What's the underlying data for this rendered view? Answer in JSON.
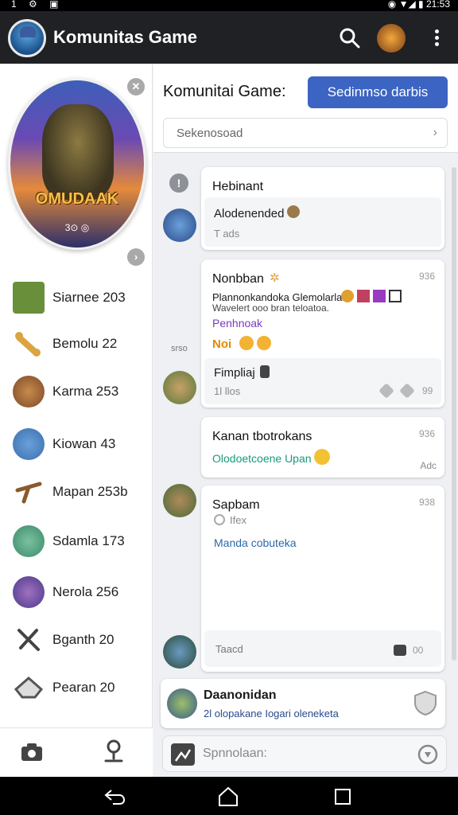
{
  "status_bar": {
    "left_icons": "1 ⚙ ▣",
    "right": "◉ ▼◢ ▮ 21:53"
  },
  "app_bar": {
    "title": "Komunitas Game"
  },
  "sidebar": {
    "hero_title": "OMUDAAK",
    "hero_sub": "3⊙ ◎",
    "items": [
      {
        "label": "Siarnee 203",
        "icon": "game-thumb-icon",
        "color": "#6a8f3a"
      },
      {
        "label": "Bemolu 22",
        "icon": "bone-icon",
        "color": "#d9a441"
      },
      {
        "label": "Karma 253",
        "icon": "hero-avatar-icon",
        "color": "#7a4a2a"
      },
      {
        "label": "Kiowan 43",
        "icon": "knight-avatar-icon",
        "color": "#3a6fb0"
      },
      {
        "label": "Mapan 253b",
        "icon": "crossbow-icon",
        "color": "#8a5a2a"
      },
      {
        "label": "Sdamla 173",
        "icon": "archer-avatar-icon",
        "color": "#3c8a6a"
      },
      {
        "label": "Nerola 256",
        "icon": "mage-avatar-icon",
        "color": "#4a3a8a"
      },
      {
        "label": "Bganth 20",
        "icon": "sword-icon",
        "color": "#444444"
      },
      {
        "label": "Pearan 20",
        "icon": "helmet-icon",
        "color": "#555555"
      }
    ]
  },
  "main": {
    "header_title": "Komunitai Game:",
    "cta_label": "Sedinmso darbis",
    "search_placeholder": "Sekenosoad",
    "side_badge": "srso",
    "posts": [
      {
        "title": "Hebinant",
        "sub_title": "Alodenended",
        "sub_detail": "T ads"
      },
      {
        "title": "Nonbban",
        "meta": "936",
        "line1": "Plannonkandoka Glemolarlan",
        "line2": "Wavelert ooo bran teloatoa.",
        "tag": "Penhnoak",
        "reaction": "Noi",
        "sub_title": "Fimpliaj",
        "sub_detail": "1l llos",
        "sub_meta": "99"
      },
      {
        "title": "Kanan tbotrokans",
        "meta": "936",
        "body": "Olodoetcoene Upan",
        "foot": "Adc"
      },
      {
        "title": "Sapbam",
        "meta": "938",
        "sub": "Ifex",
        "link": "Manda cobuteka",
        "reply": "Taacd",
        "reply_meta": "00"
      }
    ],
    "footer_card": {
      "title": "Daanonidan",
      "subtitle": "2l olopakane Iogari oleneketa"
    },
    "compose_placeholder": "Spnnolaan:"
  }
}
